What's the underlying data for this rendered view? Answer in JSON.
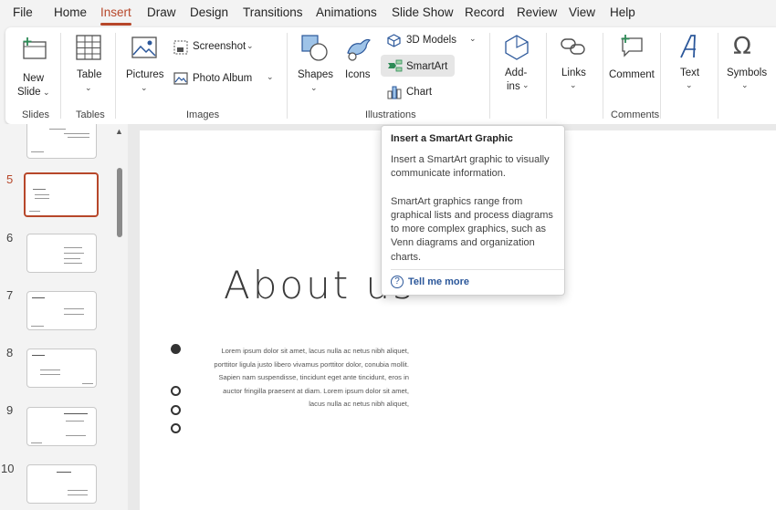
{
  "menu": {
    "tabs": [
      "File",
      "Home",
      "Insert",
      "Draw",
      "Design",
      "Transitions",
      "Animations",
      "Slide Show",
      "Record",
      "Review",
      "View",
      "Help"
    ],
    "active_tab": "Insert"
  },
  "ribbon": {
    "new_slide": [
      "New",
      "Slide"
    ],
    "table": "Table",
    "pictures": "Pictures",
    "screenshot": "Screenshot",
    "photo_album": "Photo Album",
    "shapes": "Shapes",
    "icons": "Icons",
    "models_3d": "3D Models",
    "smartart": "SmartArt",
    "chart": "Chart",
    "addins": [
      "Add-",
      "ins"
    ],
    "links": "Links",
    "comment": "Comment",
    "text": "Text",
    "symbols": "Symbols",
    "groups": {
      "slides": "Slides",
      "tables": "Tables",
      "images": "Images",
      "illustrations": "Illustrations",
      "comments": "Comments"
    }
  },
  "thumbnails": {
    "numbers": [
      "5",
      "6",
      "7",
      "8",
      "9",
      "10"
    ],
    "selected": "5"
  },
  "slide": {
    "title": "About us",
    "body": "Lorem ipsum dolor sit amet, lacus nulla ac netus nibh aliquet, porttitor ligula justo libero vivamus porttitor dolor, conubia mollit. Sapien nam suspendisse, tincidunt eget ante tincidunt, eros in auctor fringilla praesent at diam. Lorem ipsum dolor sit amet, lacus nulla ac netus nibh aliquet,"
  },
  "tooltip": {
    "title": "Insert a SmartArt Graphic",
    "p1": "Insert a SmartArt graphic to visually communicate information.",
    "p2": "SmartArt graphics range from graphical lists and process diagrams to more complex graphics, such as Venn diagrams and organization charts.",
    "more": "Tell me more"
  },
  "colors": {
    "accent": "#b7472a",
    "link": "#2b579a"
  }
}
